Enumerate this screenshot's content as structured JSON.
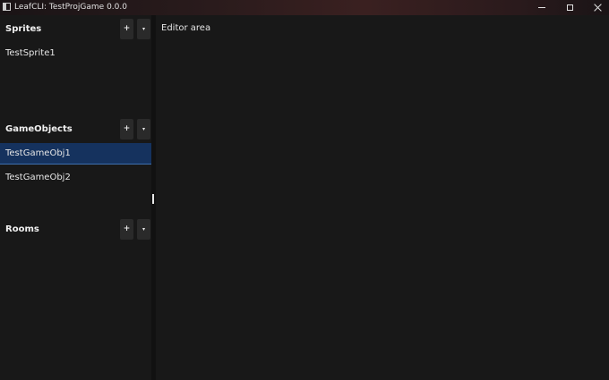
{
  "window": {
    "title": "LeafCLI: TestProjGame 0.0.0"
  },
  "sidebar": {
    "sections": [
      {
        "title": "Sprites",
        "add_label": "+",
        "menu_label": "▾",
        "items": [
          "TestSprite1"
        ]
      },
      {
        "title": "GameObjects",
        "add_label": "+",
        "menu_label": "▾",
        "items": [
          "TestGameObj1",
          "TestGameObj2"
        ],
        "selected_item": "TestGameObj1"
      },
      {
        "title": "Rooms",
        "add_label": "+",
        "menu_label": "▾",
        "items": []
      }
    ]
  },
  "editor": {
    "label": "Editor area"
  },
  "colors": {
    "background": "#181818",
    "selection": "#15325e",
    "button": "#2a2a2a"
  },
  "icons": {
    "app": "app-window-icon",
    "minimize": "minimize-icon",
    "maximize": "maximize-icon",
    "close": "close-icon",
    "add": "plus-icon",
    "menu": "chevron-down-icon"
  }
}
